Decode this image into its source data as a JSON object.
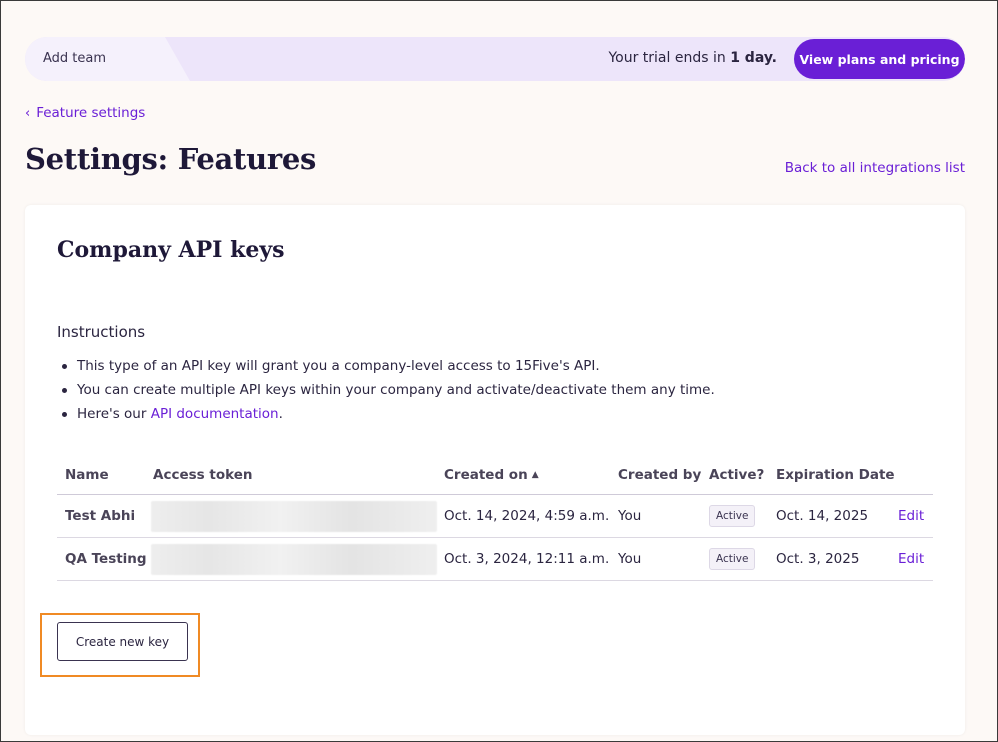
{
  "banner": {
    "team_label": "Add team",
    "trial_prefix": "Your trial ends in ",
    "trial_days": "1 day.",
    "plans_button": "View plans and pricing"
  },
  "breadcrumb": {
    "chevron": "‹",
    "label": "Feature settings"
  },
  "page": {
    "title": "Settings: Features",
    "back_link": "Back to all integrations list"
  },
  "card": {
    "title": "Company API keys",
    "instructions_heading": "Instructions",
    "instructions": {
      "item1": "This type of an API key will grant you a company-level access to 15Five's API.",
      "item2": "You can create multiple API keys within your company and activate/deactivate them any time.",
      "item3_prefix": "Here's our ",
      "item3_link": "API documentation",
      "item3_suffix": "."
    }
  },
  "table": {
    "headers": {
      "name": "Name",
      "token": "Access token",
      "created": "Created on",
      "created_by": "Created by",
      "active": "Active?",
      "expiration": "Expiration Date"
    },
    "sort_icon": "▲",
    "rows": [
      {
        "name": "Test Abhi",
        "created": "Oct. 14, 2024, 4:59 a.m.",
        "created_by": "You",
        "status": "Active",
        "expiration": "Oct. 14, 2025",
        "action": "Edit"
      },
      {
        "name": "QA Testing",
        "created": "Oct. 3, 2024, 12:11 a.m.",
        "created_by": "You",
        "status": "Active",
        "expiration": "Oct. 3, 2025",
        "action": "Edit"
      }
    ]
  },
  "actions": {
    "create_key": "Create new key"
  },
  "colors": {
    "accent": "#6a1fd6",
    "highlight": "#f08a24",
    "banner_bg": "#ede5fa",
    "page_bg": "#fdf9f6"
  }
}
